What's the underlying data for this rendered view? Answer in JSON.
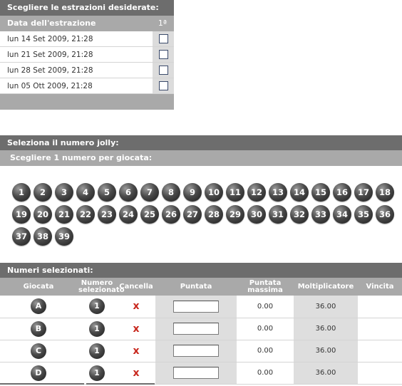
{
  "draws": {
    "title": "Scegliere le estrazioni desiderate:",
    "col_date": "Data dell'estrazione",
    "col_check": "1ª",
    "rows": [
      {
        "date": "lun 14 Set 2009, 21:28"
      },
      {
        "date": "lun 21 Set 2009, 21:28"
      },
      {
        "date": "lun 28 Set 2009, 21:28"
      },
      {
        "date": "lun 05 Ott 2009, 21:28"
      }
    ]
  },
  "jolly": {
    "title": "Seleziona il numero jolly:",
    "subtitle": "Scegliere  1 numero per giocata:",
    "numbers": [
      "1",
      "2",
      "3",
      "4",
      "5",
      "6",
      "7",
      "8",
      "9",
      "10",
      "11",
      "12",
      "13",
      "14",
      "15",
      "16",
      "17",
      "18",
      "19",
      "20",
      "21",
      "22",
      "23",
      "24",
      "25",
      "26",
      "27",
      "28",
      "29",
      "30",
      "31",
      "32",
      "33",
      "34",
      "35",
      "36",
      "37",
      "38",
      "39"
    ]
  },
  "selected": {
    "title": "Numeri selezionati:",
    "headers": {
      "giocata": "Giocata",
      "numero": "Numero selezionato",
      "cancella": "Cancella",
      "puntata": "Puntata",
      "puntata_massima": "Puntata massima",
      "moltiplicatore": "Moltiplicatore",
      "vincita": "Vincita"
    },
    "cancel_glyph": "x",
    "rows": [
      {
        "giocata": "A",
        "numero": "1",
        "puntata": "",
        "puntata_massima": "0.00",
        "moltiplicatore": "36.00",
        "vincita": ""
      },
      {
        "giocata": "B",
        "numero": "1",
        "puntata": "",
        "puntata_massima": "0.00",
        "moltiplicatore": "36.00",
        "vincita": ""
      },
      {
        "giocata": "C",
        "numero": "1",
        "puntata": "",
        "puntata_massima": "0.00",
        "moltiplicatore": "36.00",
        "vincita": ""
      },
      {
        "giocata": "D",
        "numero": "1",
        "puntata": "",
        "puntata_massima": "0.00",
        "moltiplicatore": "36.00",
        "vincita": ""
      }
    ]
  },
  "colors": {
    "bar_dark": "#6d6d6d",
    "bar_mid": "#a9a9a9",
    "cancel": "#c8281e",
    "ball": "#2a2a2a"
  }
}
